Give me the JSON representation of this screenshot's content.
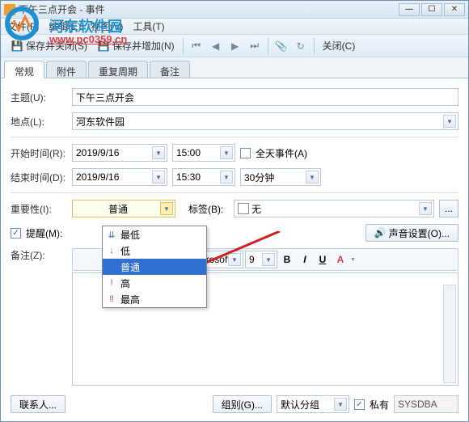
{
  "window": {
    "title": "下午三点开会 - 事件"
  },
  "menu": {
    "file": "文件(F)",
    "edit": "编辑(E)",
    "view": "视图(V)",
    "tools": "工具(T)"
  },
  "toolbar": {
    "save_close": "保存并关闭(S)",
    "save_add": "保存并增加(N)",
    "close": "关闭(C)"
  },
  "tabs": {
    "general": "常规",
    "attach": "附件",
    "recur": "重复周期",
    "notes": "备注"
  },
  "fields": {
    "subject_label": "主题(U):",
    "subject_value": "下午三点开会",
    "location_label": "地点(L):",
    "location_value": "河东软件园",
    "start_label": "开始时间(R):",
    "start_date": "2019/9/16",
    "start_time": "15:00",
    "allday_label": "全天事件(A)",
    "end_label": "结束时间(D):",
    "end_date": "2019/9/16",
    "end_time": "15:30",
    "duration": "30分钟",
    "importance_label": "重要性(I):",
    "importance_value": "普通",
    "tag_label": "标签(B):",
    "tag_value": "无",
    "remind_label": "提醒(M):",
    "sound_btn": "声音设置(O)...",
    "memo_label": "备注(Z):"
  },
  "dropdown_items": {
    "lowest": "最低",
    "low": "低",
    "normal": "普通",
    "high": "高",
    "highest": "最高"
  },
  "richtext": {
    "font": "Microsoft",
    "size": "9"
  },
  "footer": {
    "contacts": "联系人...",
    "group": "组别(G)...",
    "group_value": "默认分组",
    "private": "私有",
    "user": "SYSDBA"
  },
  "watermark": {
    "brand": "河东软件园",
    "url": "www.pc0359.cn"
  }
}
